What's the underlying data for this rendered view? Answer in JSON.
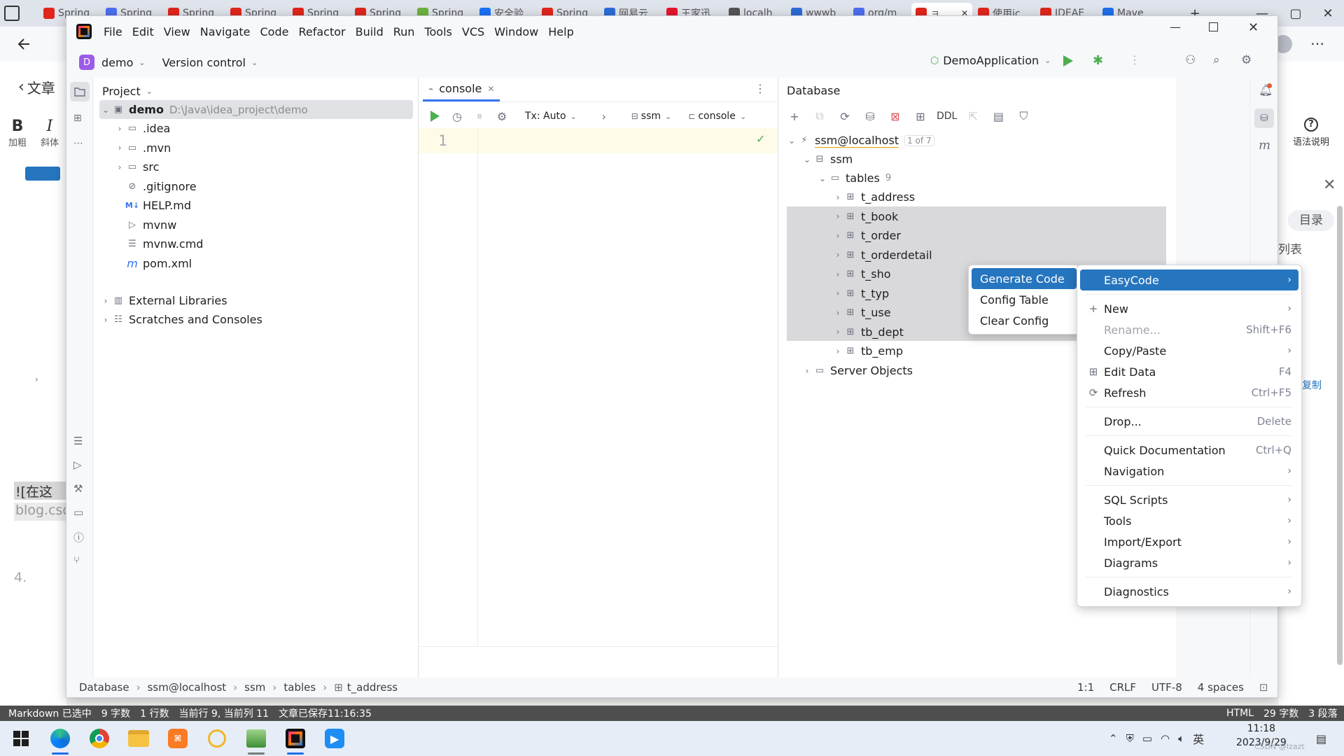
{
  "browser": {
    "tabs": [
      {
        "title": "Spring",
        "icon": "c-icon",
        "color": "#e1251b"
      },
      {
        "title": "Spring",
        "icon": "paw-icon",
        "color": "#4e6ef2"
      },
      {
        "title": "Spring",
        "icon": "c-icon",
        "color": "#e1251b"
      },
      {
        "title": "Spring",
        "icon": "c-icon",
        "color": "#e1251b"
      },
      {
        "title": "Spring",
        "icon": "c-icon",
        "color": "#e1251b"
      },
      {
        "title": "Spring",
        "icon": "c-icon",
        "color": "#e1251b"
      },
      {
        "title": "Spring",
        "icon": "leaf-icon",
        "color": "#6db33f"
      },
      {
        "title": "安全验",
        "icon": "zhihu-icon",
        "color": "#1772f6"
      },
      {
        "title": "Spring",
        "icon": "c-icon",
        "color": "#e1251b"
      },
      {
        "title": "网易云",
        "icon": "search-icon",
        "color": "#2b6cd8"
      },
      {
        "title": "王家迅",
        "icon": "weibo-icon",
        "color": "#e6162d"
      },
      {
        "title": "localh",
        "icon": "link-icon",
        "color": "#555555"
      },
      {
        "title": "wwwb",
        "icon": "search-icon",
        "color": "#2b6cd8"
      },
      {
        "title": "org/m",
        "icon": "paw-icon",
        "color": "#4e6ef2"
      },
      {
        "title": "ョ",
        "icon": "c-icon",
        "color": "#e1251b"
      },
      {
        "title": "使用ic",
        "icon": "c-icon",
        "color": "#e1251b"
      },
      {
        "title": "IDEAE",
        "icon": "c-icon",
        "color": "#e1251b"
      },
      {
        "title": "Mave",
        "icon": "mvn-icon",
        "color": "#1f6feb"
      }
    ],
    "active_tab": 14
  },
  "bg_page": {
    "back_label": "文章",
    "bold_label": "加粗",
    "italic_label": "斜体",
    "syntax_label": "语法说明",
    "toc_label": "目录",
    "list_label": "列表",
    "copy_label": "复制",
    "line1": "![在这里",
    "line2": "blog.csd",
    "number": "4."
  },
  "ide": {
    "menus": [
      "File",
      "Edit",
      "View",
      "Navigate",
      "Code",
      "Refactor",
      "Build",
      "Run",
      "Tools",
      "VCS",
      "Window",
      "Help"
    ],
    "project_badge": "D",
    "project_name": "demo",
    "version_control": "Version control",
    "run_config": "DemoApplication",
    "project_panel": {
      "title": "Project",
      "root": {
        "name": "demo",
        "path": "D:\\Java\\idea_project\\demo"
      },
      "items": [
        {
          "name": ".idea",
          "type": "folder"
        },
        {
          "name": ".mvn",
          "type": "folder"
        },
        {
          "name": "src",
          "type": "folder"
        },
        {
          "name": ".gitignore",
          "type": "ignore"
        },
        {
          "name": "HELP.md",
          "type": "md"
        },
        {
          "name": "mvnw",
          "type": "shell"
        },
        {
          "name": "mvnw.cmd",
          "type": "text"
        },
        {
          "name": "pom.xml",
          "type": "maven"
        }
      ],
      "external": "External Libraries",
      "scratches": "Scratches and Consoles"
    },
    "editor": {
      "tab": "console",
      "tx": "Tx: Auto",
      "schema": "ssm",
      "session": "console",
      "line_number": "1"
    },
    "database": {
      "title": "Database",
      "ddl": "DDL",
      "connection": "ssm@localhost",
      "connection_badge": "1 of 7",
      "schema": "ssm",
      "tables_label": "tables",
      "tables_count": "9",
      "tables": [
        "t_address",
        "t_book",
        "t_order",
        "t_orderdetail",
        "t_sho",
        "t_typ",
        "t_use",
        "tb_dept",
        "tb_emp"
      ],
      "server_objects": "Server Objects"
    },
    "easycode_menu": [
      {
        "label": "Generate Code",
        "selected": true
      },
      {
        "label": "Config Table"
      },
      {
        "label": "Clear Config"
      }
    ],
    "context_menu": [
      {
        "label": "EasyCode",
        "arrow": true,
        "selected": true
      },
      {
        "sep": true
      },
      {
        "label": "New",
        "arrow": true,
        "icon": "plus-icon"
      },
      {
        "label": "Rename...",
        "shortcut": "Shift+F6",
        "disabled": true
      },
      {
        "label": "Copy/Paste",
        "arrow": true
      },
      {
        "label": "Edit Data",
        "shortcut": "F4",
        "icon": "table-icon"
      },
      {
        "label": "Refresh",
        "shortcut": "Ctrl+F5",
        "icon": "refresh-icon"
      },
      {
        "sep": true
      },
      {
        "label": "Drop...",
        "shortcut": "Delete"
      },
      {
        "sep": true
      },
      {
        "label": "Quick Documentation",
        "shortcut": "Ctrl+Q"
      },
      {
        "label": "Navigation",
        "arrow": true
      },
      {
        "sep": true
      },
      {
        "label": "SQL Scripts",
        "arrow": true
      },
      {
        "label": "Tools",
        "arrow": true
      },
      {
        "label": "Import/Export",
        "arrow": true
      },
      {
        "label": "Diagrams",
        "arrow": true
      },
      {
        "sep": true
      },
      {
        "label": "Diagnostics",
        "arrow": true
      }
    ],
    "breadcrumb": [
      "Database",
      "ssm@localhost",
      "ssm",
      "tables",
      "t_address"
    ],
    "status_right": {
      "pos": "1:1",
      "eol": "CRLF",
      "enc": "UTF-8",
      "indent": "4 spaces"
    }
  },
  "md_status": {
    "left": [
      "Markdown 已选中",
      "9 字数",
      "1 行数",
      "当前行 9, 当前列 11",
      "文章已保存11:16:35"
    ],
    "right": [
      "HTML",
      "29 字数",
      "3 段落"
    ]
  },
  "taskbar": {
    "ime": "英",
    "time": "11:18",
    "date": "2023/9/29",
    "watermark": "CSDN @Izazt"
  }
}
